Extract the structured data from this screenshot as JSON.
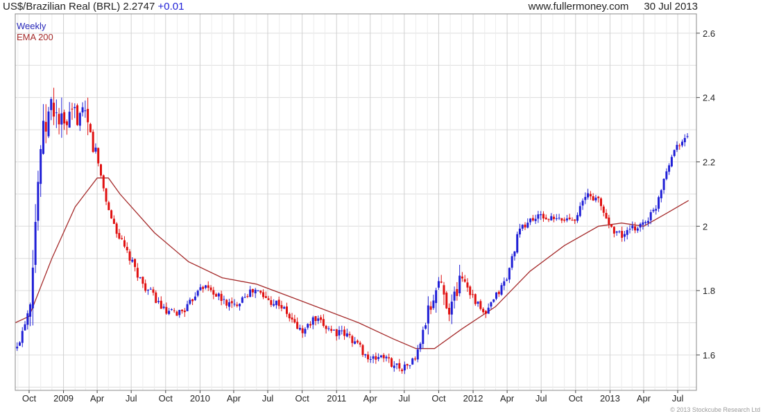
{
  "header": {
    "title": "US$/Brazilian Real (BRL)",
    "price": "2.2747",
    "change": "+0.01",
    "source": "www.fullermoney.com",
    "date": "30 Jul 2013"
  },
  "legend": {
    "series1": "Weekly",
    "series2": "EMA 200"
  },
  "copyright": "© 2013 Stockcube Research Ltd",
  "colors": {
    "up": "#1f1fd6",
    "down": "#e01010",
    "ema": "#a52a2a",
    "grid": "#dcdcdc",
    "frame": "#888888"
  },
  "chart_data": {
    "type": "line",
    "title": "US$/Brazilian Real (BRL)",
    "xlabel": "",
    "ylabel": "",
    "ylim": [
      1.49,
      2.66
    ],
    "y_ticks": [
      1.6,
      1.8,
      2.0,
      2.2,
      2.4,
      2.6
    ],
    "y_tick_labels": [
      "1.6",
      "1.8",
      "2",
      "2.2",
      "2.4",
      "2.6"
    ],
    "x_ticks": [
      "2008-10-01",
      "2009-01-01",
      "2009-04-01",
      "2009-07-01",
      "2009-10-01",
      "2010-01-01",
      "2010-04-01",
      "2010-07-01",
      "2010-10-01",
      "2011-01-01",
      "2011-04-01",
      "2011-07-01",
      "2011-10-01",
      "2012-01-01",
      "2012-04-01",
      "2012-07-01",
      "2012-10-01",
      "2013-01-01",
      "2013-04-01",
      "2013-07-01"
    ],
    "x_tick_labels": [
      "Oct",
      "2009",
      "Apr",
      "Jul",
      "Oct",
      "2010",
      "Apr",
      "Jul",
      "Oct",
      "2011",
      "Apr",
      "Jul",
      "Oct",
      "2012",
      "Apr",
      "Jul",
      "Oct",
      "2013",
      "Apr",
      "Jul"
    ],
    "x_range": [
      "2008-08-25",
      "2013-08-20"
    ],
    "grid": true,
    "legend_position": "top-left",
    "series": [
      {
        "name": "Weekly",
        "style": "candlestick",
        "x": [
          "2008-08-30",
          "2008-10-01",
          "2008-11-01",
          "2008-12-01",
          "2009-01-01",
          "2009-02-01",
          "2009-03-01",
          "2009-04-01",
          "2009-05-01",
          "2009-06-01",
          "2009-07-01",
          "2009-08-01",
          "2009-09-01",
          "2009-10-01",
          "2009-11-01",
          "2009-12-01",
          "2010-01-01",
          "2010-02-01",
          "2010-03-01",
          "2010-04-01",
          "2010-05-01",
          "2010-06-01",
          "2010-07-01",
          "2010-08-01",
          "2010-09-01",
          "2010-10-01",
          "2010-11-01",
          "2010-12-01",
          "2011-01-01",
          "2011-02-01",
          "2011-03-01",
          "2011-04-01",
          "2011-05-01",
          "2011-06-01",
          "2011-07-01",
          "2011-08-01",
          "2011-09-01",
          "2011-10-01",
          "2011-11-01",
          "2011-12-01",
          "2012-01-01",
          "2012-02-01",
          "2012-03-01",
          "2012-04-01",
          "2012-05-01",
          "2012-06-01",
          "2012-07-01",
          "2012-08-01",
          "2012-09-01",
          "2012-10-01",
          "2012-11-01",
          "2012-12-01",
          "2013-01-01",
          "2013-02-01",
          "2013-03-01",
          "2013-04-01",
          "2013-05-01",
          "2013-06-01",
          "2013-07-01",
          "2013-07-30"
        ],
        "values": [
          1.62,
          1.75,
          2.25,
          2.38,
          2.3,
          2.35,
          2.33,
          2.21,
          2.05,
          1.96,
          1.89,
          1.82,
          1.78,
          1.73,
          1.73,
          1.75,
          1.82,
          1.8,
          1.77,
          1.75,
          1.79,
          1.8,
          1.77,
          1.76,
          1.71,
          1.67,
          1.71,
          1.69,
          1.67,
          1.66,
          1.63,
          1.58,
          1.6,
          1.57,
          1.56,
          1.59,
          1.72,
          1.83,
          1.74,
          1.85,
          1.78,
          1.72,
          1.78,
          1.84,
          1.98,
          2.02,
          2.03,
          2.02,
          2.02,
          2.03,
          2.1,
          2.08,
          2.0,
          1.97,
          1.99,
          2.01,
          2.05,
          2.18,
          2.26,
          2.2747
        ]
      },
      {
        "name": "EMA 200",
        "style": "line",
        "x": [
          "2008-08-25",
          "2008-10-01",
          "2008-12-01",
          "2009-02-01",
          "2009-04-01",
          "2009-05-01",
          "2009-06-01",
          "2009-09-01",
          "2009-12-01",
          "2010-03-01",
          "2010-06-01",
          "2010-09-01",
          "2010-12-01",
          "2011-03-01",
          "2011-06-01",
          "2011-08-01",
          "2011-09-20",
          "2011-12-01",
          "2012-03-01",
          "2012-06-01",
          "2012-09-01",
          "2012-12-01",
          "2013-02-01",
          "2013-04-01",
          "2013-06-01",
          "2013-07-30"
        ],
        "values": [
          1.7,
          1.72,
          1.9,
          2.06,
          2.15,
          2.15,
          2.1,
          1.98,
          1.89,
          1.84,
          1.82,
          1.78,
          1.74,
          1.7,
          1.65,
          1.62,
          1.62,
          1.68,
          1.75,
          1.86,
          1.94,
          2.0,
          2.01,
          2.0,
          2.04,
          2.08
        ]
      }
    ]
  }
}
